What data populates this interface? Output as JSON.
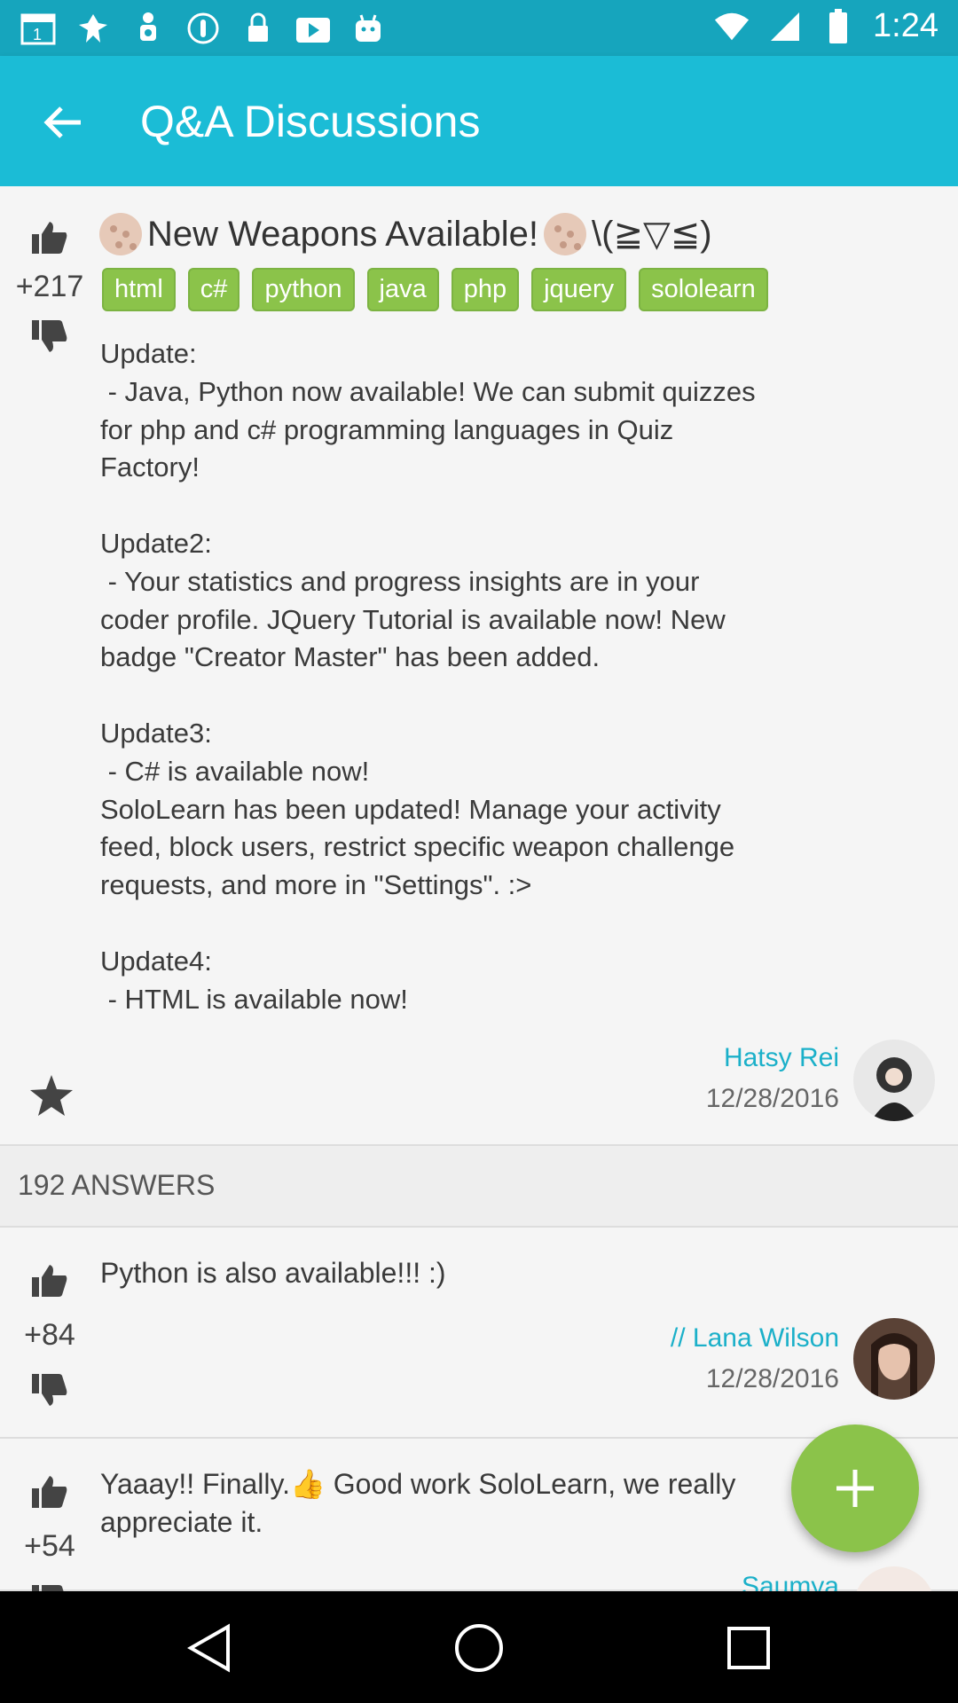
{
  "status_bar": {
    "time": "1:24"
  },
  "app_bar": {
    "title": "Q&A Discussions"
  },
  "question": {
    "votes": "+217",
    "title": "New Weapons Available!",
    "title_suffix": "\\(≧▽≦)",
    "tags": [
      "html",
      "c#",
      "python",
      "java",
      "php",
      "jquery",
      "sololearn"
    ],
    "body": "Update:\n - Java, Python now available! We can submit quizzes\nfor php and c# programming languages in Quiz\nFactory!\n\nUpdate2:\n - Your statistics and progress insights are in your\ncoder profile. JQuery Tutorial is available now! New\nbadge \"Creator Master\" has been added.\n\nUpdate3:\n - C# is available now!\nSoloLearn has been updated! Manage your activity\nfeed, block users, restrict specific weapon challenge\nrequests, and more in \"Settings\". :>\n\nUpdate4:\n - HTML is available now!",
    "author": "Hatsy Rei",
    "date": "12/28/2016"
  },
  "answers_header": "192 ANSWERS",
  "answers": [
    {
      "votes": "+84",
      "text": "Python is also available!!! :)",
      "author": "// Lana Wilson",
      "date": "12/28/2016"
    },
    {
      "votes": "+54",
      "text": "Yaaay!! Finally.👍 Good work SoloLearn, we really appreciate it.",
      "author": "Saumya",
      "date": ""
    }
  ],
  "colors": {
    "primary": "#1bbcd6",
    "status_bar": "#16a5bd",
    "accent": "#8bc34a",
    "author": "#1bb0c9"
  }
}
